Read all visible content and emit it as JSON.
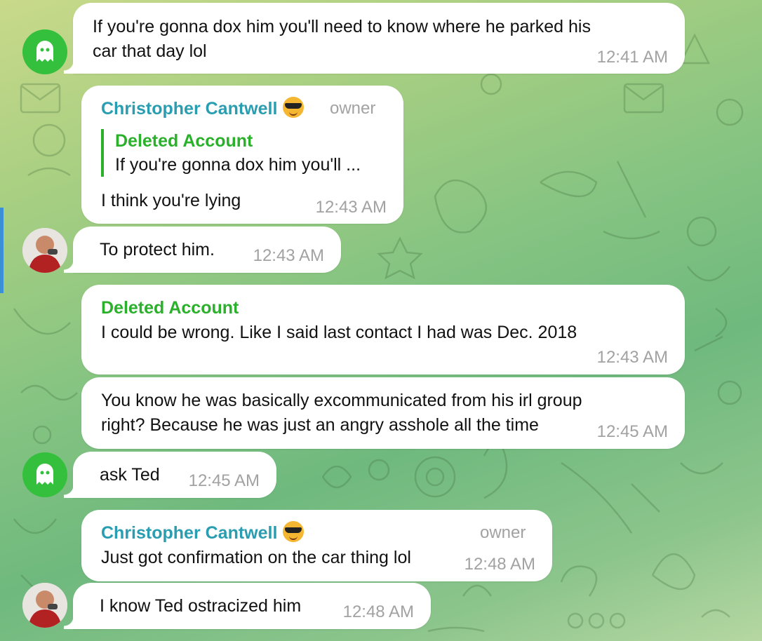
{
  "theme": {
    "bubble_color": "#ffffff",
    "cantwell_name_color": "#2a9db0",
    "deleted_name_color": "#2bb02b",
    "time_color": "#a2a2a2",
    "ghost_avatar_color": "#34c03c"
  },
  "messages": [
    {
      "text_lines": [
        "If you're gonna dox him you'll need to know where he parked his",
        "car that day lol"
      ],
      "time": "12:41 AM",
      "avatar": "ghost-avatar-icon"
    },
    {
      "sender": "Christopher Cantwell",
      "sender_emoji": "sunglasses-emoji-icon",
      "role": "owner",
      "reply": {
        "name": "Deleted Account",
        "text": "If you're gonna dox him you'll ..."
      },
      "text": "I think you're lying",
      "time": "12:43 AM"
    },
    {
      "text": "To protect him.",
      "time": "12:43 AM",
      "avatar": "cantwell-avatar"
    },
    {
      "sender": "Deleted Account",
      "text": "I could be wrong. Like I said last contact I had was Dec. 2018",
      "time": "12:43 AM"
    },
    {
      "text_lines": [
        "You know he was basically excommunicated from his irl group",
        "right? Because he was just an angry asshole all the time"
      ],
      "time": "12:45 AM"
    },
    {
      "text": "ask Ted",
      "time": "12:45 AM",
      "avatar": "ghost-avatar-icon"
    },
    {
      "sender": "Christopher Cantwell",
      "sender_emoji": "sunglasses-emoji-icon",
      "role": "owner",
      "text": "Just got confirmation on the car thing lol",
      "time": "12:48 AM"
    },
    {
      "text": "I know Ted ostracized him",
      "time": "12:48 AM",
      "avatar": "cantwell-avatar"
    }
  ]
}
